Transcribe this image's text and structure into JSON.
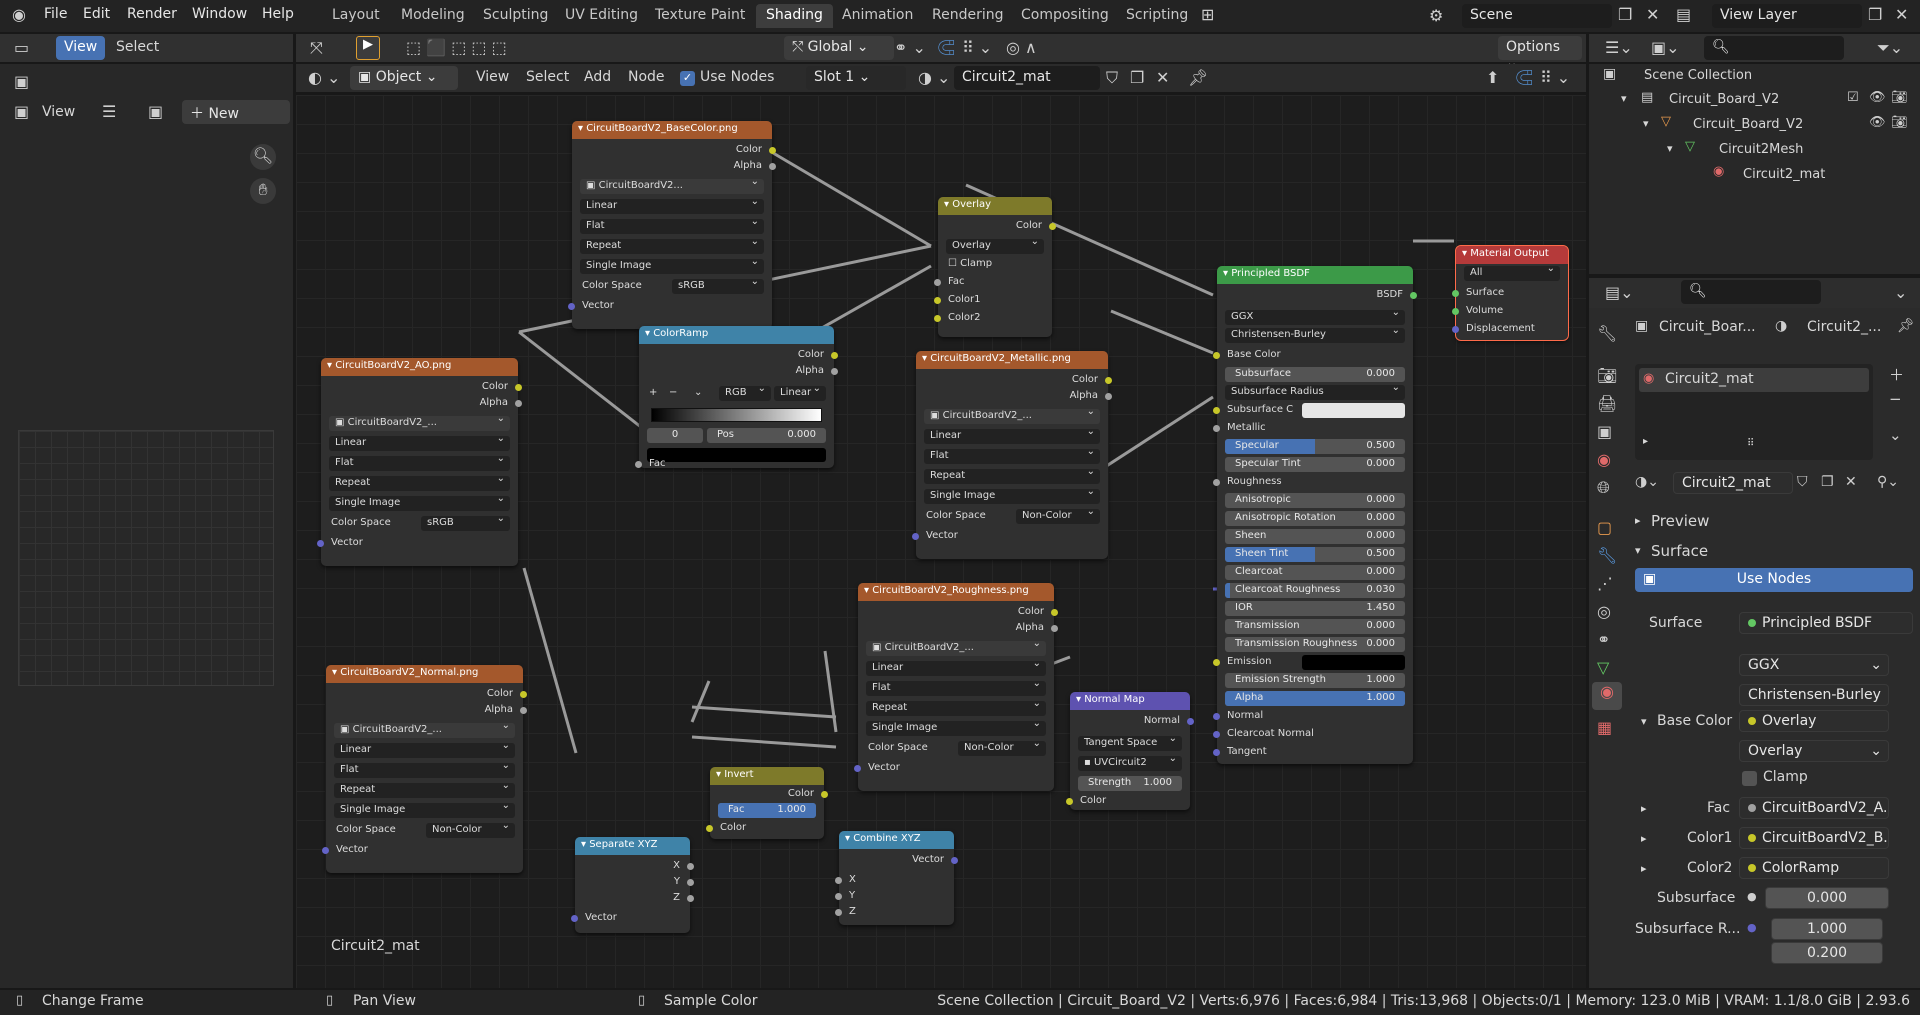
{
  "topbar": {
    "menus": [
      "File",
      "Edit",
      "Render",
      "Window",
      "Help"
    ],
    "workspaces": [
      "Layout",
      "Modeling",
      "Sculpting",
      "UV Editing",
      "Texture Paint",
      "Shading",
      "Animation",
      "Rendering",
      "Compositing",
      "Scripting"
    ],
    "active_workspace": "Shading",
    "scene": "Scene",
    "view_layer": "View Layer"
  },
  "image_editor": {
    "view": "View",
    "select": "Select",
    "view2": "View",
    "new": "New"
  },
  "node_header": {
    "transform": "Global",
    "options": "Options",
    "object": "Object",
    "view": "View",
    "select": "Select",
    "add": "Add",
    "node": "Node",
    "use_nodes": "Use Nodes",
    "slot": "Slot 1",
    "material": "Circuit2_mat"
  },
  "nodes": {
    "basecolor": {
      "title": "CircuitBoardV2_BaseColor.png",
      "color": "Color",
      "alpha": "Alpha",
      "image": "CircuitBoardV2...",
      "interp": "Linear",
      "proj": "Flat",
      "ext": "Repeat",
      "src": "Single Image",
      "cs_label": "Color Space",
      "cs": "sRGB",
      "vector": "Vector"
    },
    "ao": {
      "title": "CircuitBoardV2_AO.png",
      "color": "Color",
      "alpha": "Alpha",
      "image": "CircuitBoardV2_...",
      "interp": "Linear",
      "proj": "Flat",
      "ext": "Repeat",
      "src": "Single Image",
      "cs_label": "Color Space",
      "cs": "sRGB",
      "vector": "Vector"
    },
    "normal": {
      "title": "CircuitBoardV2_Normal.png",
      "color": "Color",
      "alpha": "Alpha",
      "image": "CircuitBoardV2_...",
      "interp": "Linear",
      "proj": "Flat",
      "ext": "Repeat",
      "src": "Single Image",
      "cs_label": "Color Space",
      "cs": "Non-Color",
      "vector": "Vector"
    },
    "metallic": {
      "title": "CircuitBoardV2_Metallic.png",
      "color": "Color",
      "alpha": "Alpha",
      "image": "CircuitBoardV2_...",
      "interp": "Linear",
      "proj": "Flat",
      "ext": "Repeat",
      "src": "Single Image",
      "cs_label": "Color Space",
      "cs": "Non-Color",
      "vector": "Vector"
    },
    "rough": {
      "title": "CircuitBoardV2_Roughness.png",
      "color": "Color",
      "alpha": "Alpha",
      "image": "CircuitBoardV2_...",
      "interp": "Linear",
      "proj": "Flat",
      "ext": "Repeat",
      "src": "Single Image",
      "cs_label": "Color Space",
      "cs": "Non-Color",
      "vector": "Vector"
    },
    "overlay": {
      "title": "Overlay",
      "color": "Color",
      "mode": "Overlay",
      "clamp": "Clamp",
      "fac": "Fac",
      "c1": "Color1",
      "c2": "Color2"
    },
    "ramp": {
      "title": "ColorRamp",
      "color": "Color",
      "alpha": "Alpha",
      "plus": "+",
      "minus": "−",
      "mode": "RGB",
      "interp": "Linear",
      "index": "0",
      "pos_label": "Pos",
      "pos": "0.000",
      "fac": "Fac"
    },
    "invert": {
      "title": "Invert",
      "color": "Color",
      "fac_label": "Fac",
      "fac": "1.000",
      "color_in": "Color"
    },
    "sepxyz": {
      "title": "Separate XYZ",
      "x": "X",
      "y": "Y",
      "z": "Z",
      "vector": "Vector"
    },
    "combxyz": {
      "title": "Combine XYZ",
      "vector": "Vector",
      "x": "X",
      "y": "Y",
      "z": "Z"
    },
    "normalmap": {
      "title": "Normal Map",
      "normal": "Normal",
      "space": "Tangent Space",
      "uv": "UVCircuit2",
      "strength_label": "Strength",
      "strength": "1.000",
      "color": "Color"
    },
    "output": {
      "title": "Material Output",
      "target": "All",
      "surface": "Surface",
      "volume": "Volume",
      "displacement": "Displacement"
    },
    "bsdf": {
      "title": "Principled BSDF",
      "bsdf": "BSDF",
      "dist": "GGX",
      "sss": "Christensen-Burley",
      "base": "Base Color",
      "subsurface": "Subsurface",
      "subsurface_v": "0.000",
      "sss_radius": "Subsurface Radius",
      "sss_color": "Subsurface C",
      "metallic": "Metallic",
      "specular": "Specular",
      "specular_v": "0.500",
      "spec_tint": "Specular Tint",
      "spec_tint_v": "0.000",
      "roughness": "Roughness",
      "aniso": "Anisotropic",
      "aniso_v": "0.000",
      "aniso_rot": "Anisotropic Rotation",
      "aniso_rot_v": "0.000",
      "sheen": "Sheen",
      "sheen_v": "0.000",
      "sheen_tint": "Sheen Tint",
      "sheen_tint_v": "0.500",
      "clearcoat": "Clearcoat",
      "clearcoat_v": "0.000",
      "cc_rough": "Clearcoat Roughness",
      "cc_rough_v": "0.030",
      "ior": "IOR",
      "ior_v": "1.450",
      "trans": "Transmission",
      "trans_v": "0.000",
      "trans_rough": "Transmission Roughness",
      "trans_rough_v": "0.000",
      "emission": "Emission",
      "em_strength": "Emission Strength",
      "em_strength_v": "1.000",
      "alpha": "Alpha",
      "alpha_v": "1.000",
      "normal": "Normal",
      "cc_normal": "Clearcoat Normal",
      "tangent": "Tangent"
    }
  },
  "editor_label": "Circuit2_mat",
  "outliner": {
    "title": "Scene Collection",
    "items": [
      "Circuit_Board_V2",
      "Circuit_Board_V2",
      "Circuit2Mesh",
      "Circuit2_mat"
    ]
  },
  "props": {
    "object": "Circuit_Boar...",
    "material_short": "Circuit2_...",
    "slot_name": "Circuit2_mat",
    "mat_field": "Circuit2_mat",
    "preview": "Preview",
    "surface_section": "Surface",
    "use_nodes": "Use Nodes",
    "surface_label": "Surface",
    "surface_val": "Principled BSDF",
    "dist": "GGX",
    "sss": "Christensen-Burley",
    "base_label": "Base Color",
    "base_val": "Overlay",
    "blend": "Overlay",
    "clamp": "Clamp",
    "fac_label": "Fac",
    "fac_val": "CircuitBoardV2_A...",
    "c1_label": "Color1",
    "c1_val": "CircuitBoardV2_B...",
    "c2_label": "Color2",
    "c2_val": "ColorRamp",
    "sub_label": "Subsurface",
    "sub_val": "0.000",
    "subr_label": "Subsurface R...",
    "subr_v1": "1.000",
    "subr_v2": "0.200"
  },
  "status": {
    "change_frame": "Change Frame",
    "pan_view": "Pan View",
    "sample_color": "Sample Color",
    "stats": "Scene Collection | Circuit_Board_V2 | Verts:6,976 | Faces:6,984 | Tris:13,968 | Objects:0/1 | Memory: 123.0 MiB | VRAM: 1.1/8.0 GiB | 2.93.6"
  }
}
